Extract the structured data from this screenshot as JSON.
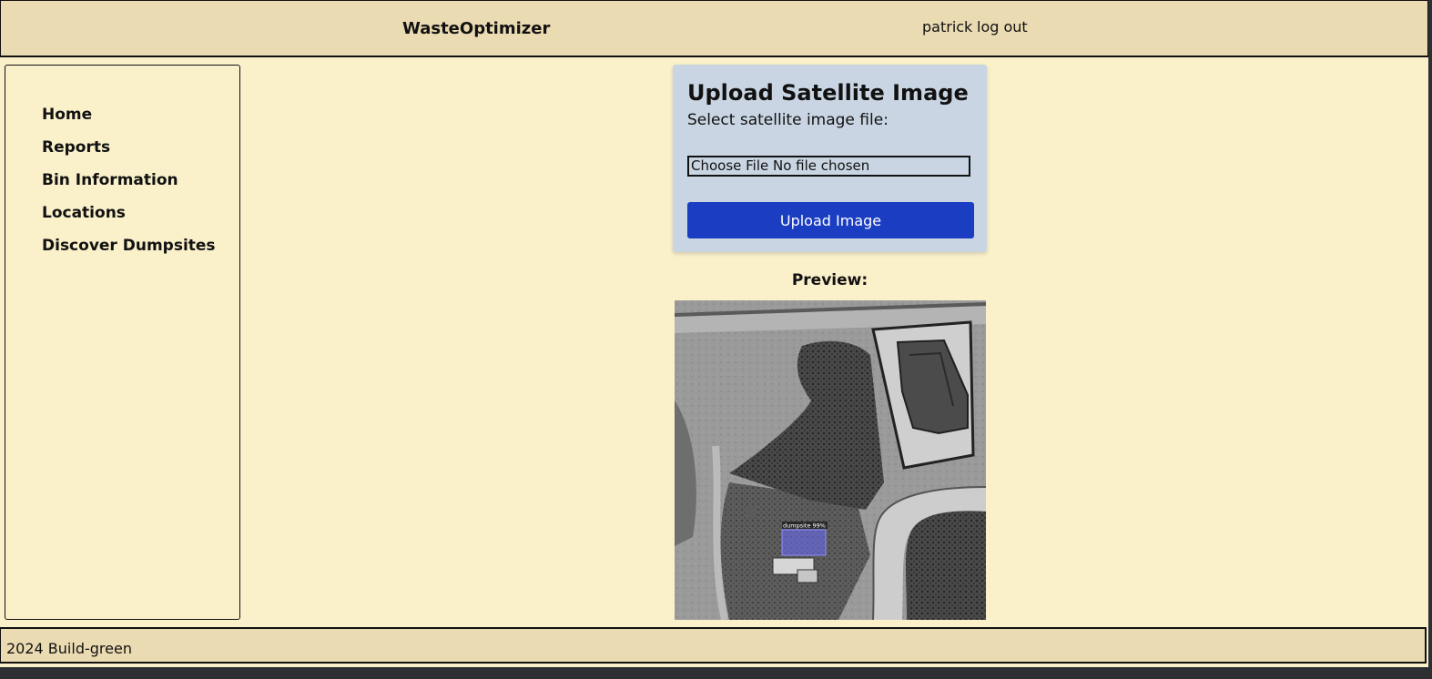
{
  "header": {
    "brand": "WasteOptimizer",
    "username": "patrick",
    "logout_label": "log out"
  },
  "sidebar": {
    "items": [
      {
        "label": "Home"
      },
      {
        "label": "Reports"
      },
      {
        "label": "Bin Information"
      },
      {
        "label": "Locations"
      },
      {
        "label": "Discover Dumpsites"
      }
    ]
  },
  "upload": {
    "title": "Upload Satellite Image",
    "label": "Select satellite image file:",
    "file_input_text": "Choose File No file chosen",
    "button_label": "Upload Image"
  },
  "preview": {
    "label": "Preview:",
    "detection_label": "dumpsite 99%"
  },
  "footer": {
    "text": "2024 Build-green"
  },
  "colors": {
    "header_bg": "#ebdbb2",
    "page_bg": "#faf0ca",
    "card_bg": "#c9d5e3",
    "button_bg": "#1b3dc2",
    "detection_box": "#6b6bff"
  }
}
